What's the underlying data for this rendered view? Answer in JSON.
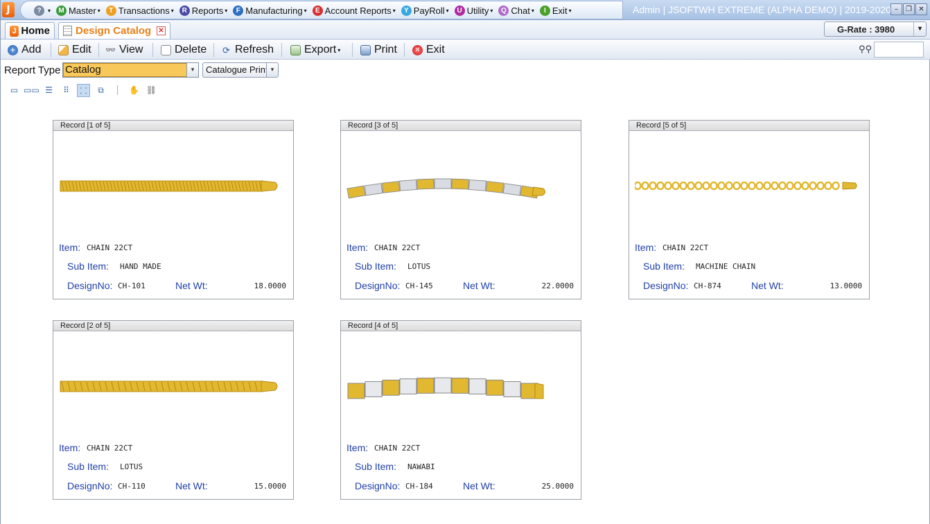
{
  "app": {
    "logo": "J",
    "title": "Admin | JSOFTWH EXTREME (ALPHA DEMO)  | 2019-2020"
  },
  "menu": [
    {
      "label": "",
      "icon": "?",
      "color": "#7a8aa0",
      "name": "help"
    },
    {
      "label": "Master",
      "icon": "M",
      "color": "#3a9a3a",
      "name": "master"
    },
    {
      "label": "Transactions",
      "icon": "T",
      "color": "#f0a020",
      "name": "transactions"
    },
    {
      "label": "Reports",
      "icon": "R",
      "color": "#4a4aa8",
      "name": "reports"
    },
    {
      "label": "Manufacturing",
      "icon": "F",
      "color": "#2f6fc0",
      "name": "manufacturing"
    },
    {
      "label": "Account Reports",
      "icon": "E",
      "color": "#d83030",
      "name": "account-reports"
    },
    {
      "label": "PayRoll",
      "icon": "Y",
      "color": "#3aa8e0",
      "name": "payroll"
    },
    {
      "label": "Utility",
      "icon": "U",
      "color": "#b02aa0",
      "name": "utility"
    },
    {
      "label": "Chat",
      "icon": "Q",
      "color": "#b06ac8",
      "name": "chat"
    },
    {
      "label": "Exit",
      "icon": "I",
      "color": "#4aa02a",
      "name": "exit"
    }
  ],
  "tabs": {
    "home": "Home",
    "catalog": "Design Catalog"
  },
  "grate": "G-Rate : 3980",
  "toolbar": {
    "add": "Add",
    "edit": "Edit",
    "view": "View",
    "delete": "Delete",
    "refresh": "Refresh",
    "export": "Export",
    "print": "Print",
    "exit": "Exit"
  },
  "report": {
    "label": "Report Type",
    "type_value": "Catalog",
    "print_value": "Catalogue Print"
  },
  "field_labels": {
    "item": "Item:",
    "sub_item": "Sub Item:",
    "design_no": "DesignNo:",
    "net_wt": "Net Wt:"
  },
  "records": [
    {
      "header": "Record [1 of 5]",
      "item": "CHAIN 22CT",
      "sub_item": "HAND MADE",
      "design_no": "CH-101",
      "net_wt": "18.0000",
      "style": "mesh"
    },
    {
      "header": "Record [3 of 5]",
      "item": "CHAIN 22CT",
      "sub_item": "LOTUS",
      "design_no": "CH-145",
      "net_wt": "22.0000",
      "style": "twotone"
    },
    {
      "header": "Record [5 of 5]",
      "item": "CHAIN 22CT",
      "sub_item": "MACHINE CHAIN",
      "design_no": "CH-874",
      "net_wt": "13.0000",
      "style": "rings"
    },
    {
      "header": "Record [2 of 5]",
      "item": "CHAIN 22CT",
      "sub_item": "LOTUS",
      "design_no": "CH-110",
      "net_wt": "15.0000",
      "style": "links"
    },
    {
      "header": "Record [4 of 5]",
      "item": "CHAIN 22CT",
      "sub_item": "NAWABI",
      "design_no": "CH-184",
      "net_wt": "25.0000",
      "style": "nawabi"
    }
  ]
}
